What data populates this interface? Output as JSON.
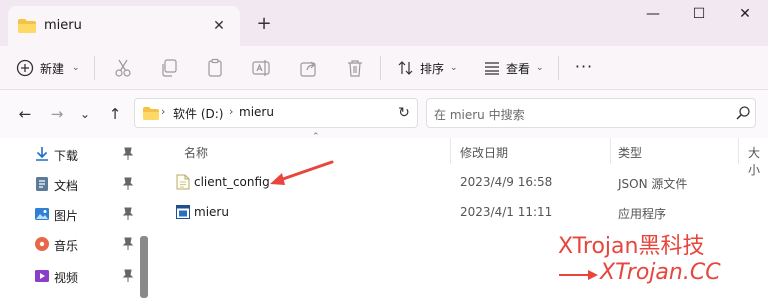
{
  "tab": {
    "title": "mieru",
    "close_glyph": "✕",
    "new_glyph": "+"
  },
  "window": {
    "minimize_glyph": "—",
    "maximize_glyph": "☐",
    "close_glyph": "✕"
  },
  "toolbar": {
    "new_label": "新建",
    "sort_label": "排序",
    "view_label": "查看",
    "more_glyph": "···",
    "chevron_glyph": "⌄",
    "icons": [
      "cut-icon",
      "copy-icon",
      "paste-icon",
      "rename-icon",
      "share-icon",
      "delete-icon"
    ]
  },
  "nav": {
    "back_glyph": "←",
    "forward_glyph": "→",
    "recent_glyph": "⌄",
    "up_glyph": "↑",
    "address": {
      "drive": "软件 (D:)",
      "folder": "mieru",
      "sep_glyph": "›",
      "refresh_glyph": "↻"
    },
    "search_placeholder": "在 mieru 中搜索"
  },
  "sidebar": {
    "items": [
      {
        "label": "下载",
        "icon": "download-icon"
      },
      {
        "label": "文档",
        "icon": "documents-icon"
      },
      {
        "label": "图片",
        "icon": "pictures-icon"
      },
      {
        "label": "音乐",
        "icon": "music-icon"
      },
      {
        "label": "视频",
        "icon": "videos-icon"
      }
    ]
  },
  "columns": {
    "name": "名称",
    "modified": "修改日期",
    "type": "类型",
    "size": "大小",
    "sort_caret": "⌃"
  },
  "files": [
    {
      "name": "client_config",
      "modified": "2023/4/9 16:58",
      "type": "JSON 源文件",
      "icon": "json-file-icon"
    },
    {
      "name": "mieru",
      "modified": "2023/4/1 11:11",
      "type": "应用程序",
      "icon": "application-icon"
    }
  ],
  "watermark": {
    "title": "XTrojan黑科技",
    "url": "XTrojan.CC"
  },
  "colors": {
    "accent_red": "#e8453c",
    "folder_yellow": "#f5c245",
    "titlebar_bg": "#f1e8f2"
  }
}
